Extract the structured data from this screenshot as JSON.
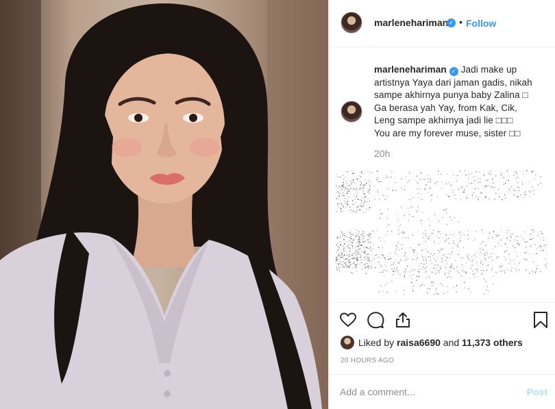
{
  "post": {
    "username": "marlenehariman",
    "follow_label": "Follow",
    "separator": "•",
    "verified_mark": "✓"
  },
  "caption": {
    "username": "marlenehariman",
    "lines": [
      "Jadi make up",
      "artistnya Yaya dari jaman gadis, nikah",
      "sampe akhirnya punya baby Zalina □",
      "Ga berasa yah Yay, from Kak, Cik,",
      "Leng sampe akhirnya jadi lie □□□",
      "You are my forever muse, sister □□"
    ],
    "relative_time": "20h"
  },
  "likes": {
    "prefix": "Liked by",
    "user": "raisa6690",
    "middle": "and",
    "others": "11,373 others"
  },
  "timestamp": "20 HOURS AGO",
  "comment": {
    "placeholder": "Add a comment...",
    "post_label": "Post"
  },
  "icons": {
    "like": "heart-icon",
    "comment": "comment-bubble-icon",
    "share": "share-icon",
    "save": "bookmark-icon"
  }
}
